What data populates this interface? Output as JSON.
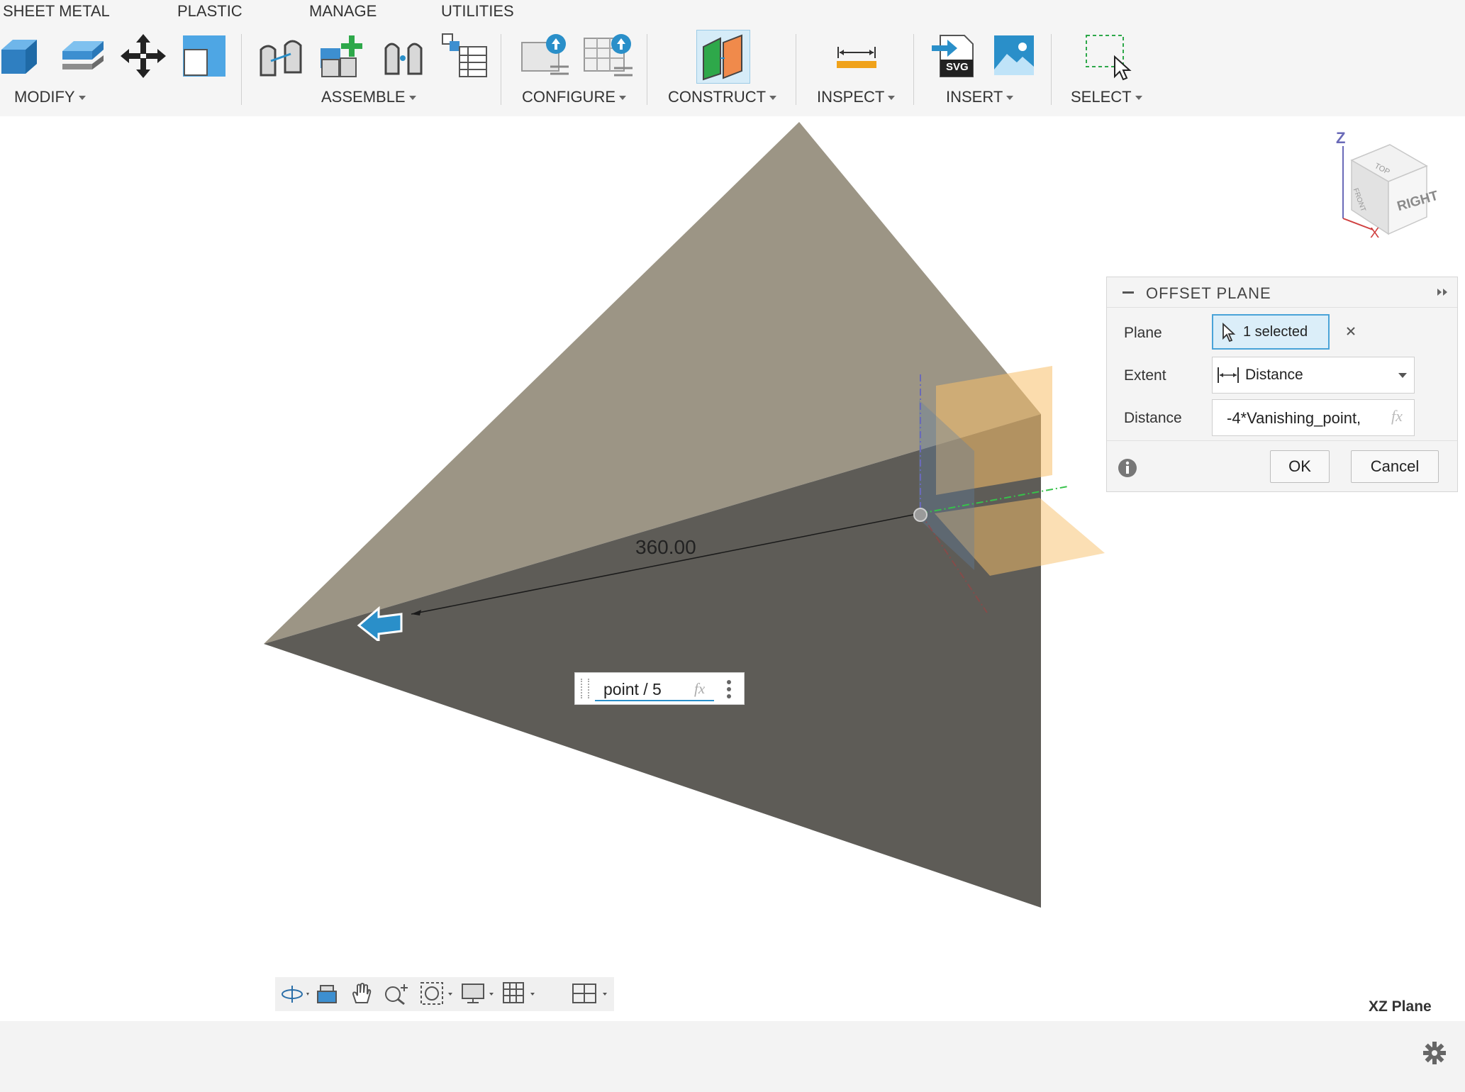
{
  "tabs": [
    "SHEET METAL",
    "PLASTIC",
    "MANAGE",
    "UTILITIES"
  ],
  "toolbar": {
    "groups": {
      "modify": "MODIFY",
      "assemble": "ASSEMBLE",
      "configure": "CONFIGURE",
      "construct": "CONSTRUCT",
      "inspect": "INSPECT",
      "insert": "INSERT",
      "select": "SELECT"
    },
    "svg_badge": "SVG"
  },
  "viewport": {
    "dimension_value": "360.00",
    "inline_expression": "point / 5",
    "fx_label": "fx",
    "view_label": "XZ Plane"
  },
  "viewcube": {
    "face_right": "RIGHT",
    "face_top": "TOP",
    "face_front": "FRONT",
    "axis_z": "Z",
    "axis_x": "X"
  },
  "offset_plane": {
    "title": "OFFSET PLANE",
    "plane_label": "Plane",
    "plane_value": "1 selected",
    "extent_label": "Extent",
    "extent_value": "Distance",
    "distance_label": "Distance",
    "distance_value": "-4*Vanishing_point,",
    "fx_label": "fx",
    "ok_label": "OK",
    "cancel_label": "Cancel"
  },
  "colors": {
    "plane_light": "#9c9585",
    "plane_dark": "#5e5c57",
    "accent_blue": "#2a8fc9",
    "construction_orange": "#f7c06a"
  }
}
